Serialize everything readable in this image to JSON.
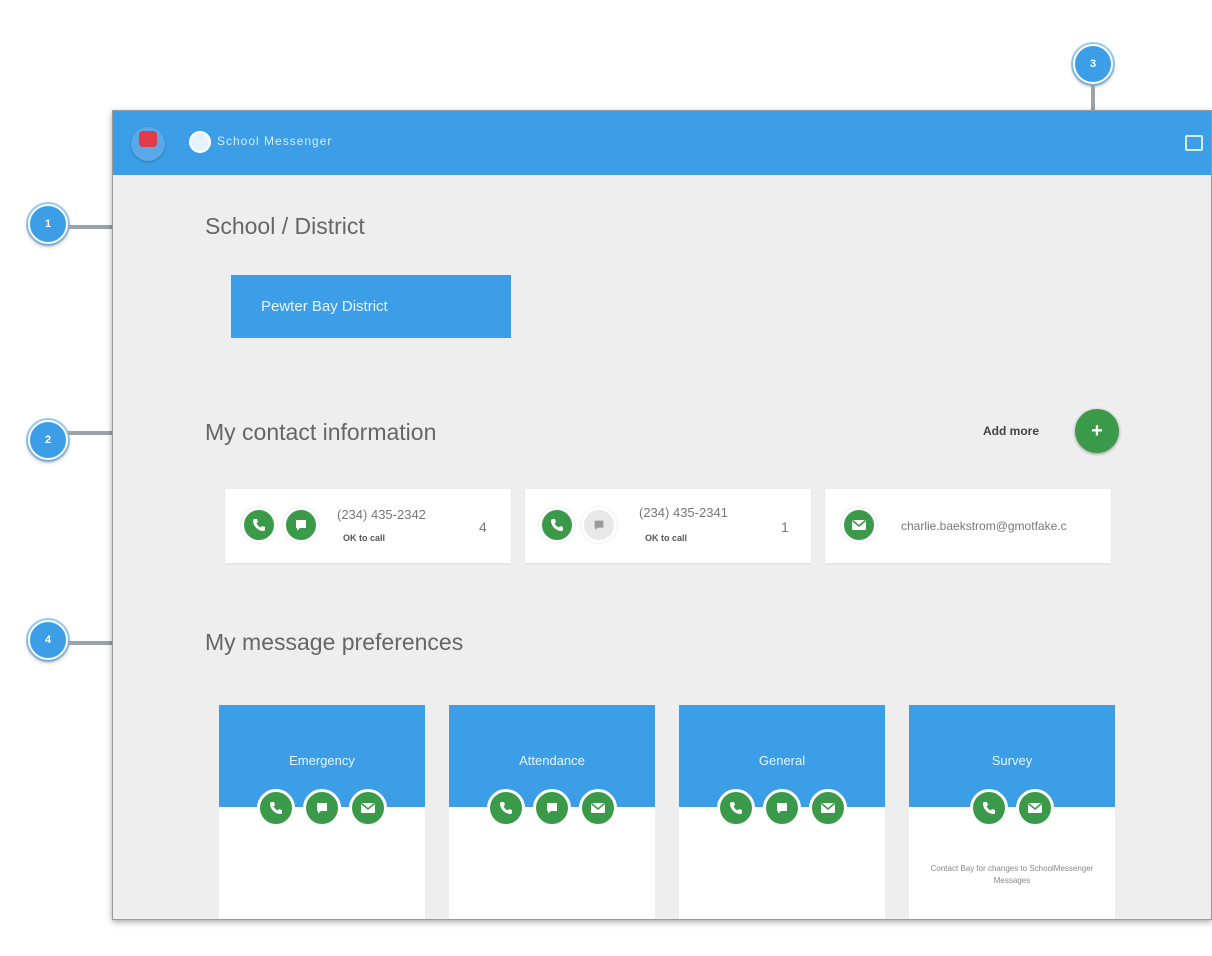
{
  "app": {
    "title": "School Messenger"
  },
  "callouts": [
    "1",
    "2",
    "3",
    "4"
  ],
  "sections": {
    "school_district": "School / District",
    "contact_info": "My contact information",
    "message_prefs": "My message preferences"
  },
  "district_button": "Pewter Bay District",
  "add_more": {
    "label": "Add more",
    "icon": "+"
  },
  "contacts": [
    {
      "type": "phone",
      "number": "(234) 435-2342",
      "sub": "OK to call",
      "count": "4"
    },
    {
      "type": "phone",
      "number": "(234) 435-2341",
      "sub": "OK to call",
      "count": "1"
    },
    {
      "type": "email",
      "address": "charlie.baekstrom@gmotfake.c"
    }
  ],
  "preferences": [
    {
      "name": "Emergency",
      "channels": [
        "phone",
        "sms",
        "email"
      ],
      "note": ""
    },
    {
      "name": "Attendance",
      "channels": [
        "phone",
        "sms",
        "email"
      ],
      "note": ""
    },
    {
      "name": "General",
      "channels": [
        "phone",
        "sms",
        "email"
      ],
      "note": ""
    },
    {
      "name": "Survey",
      "channels": [
        "phone",
        "email"
      ],
      "note": "Contact Bay for changes to SchoolMessenger Messages"
    }
  ],
  "colors": {
    "primary": "#3b9ee6",
    "accent_green": "#3a9a4a",
    "background": "#eeeeee"
  }
}
